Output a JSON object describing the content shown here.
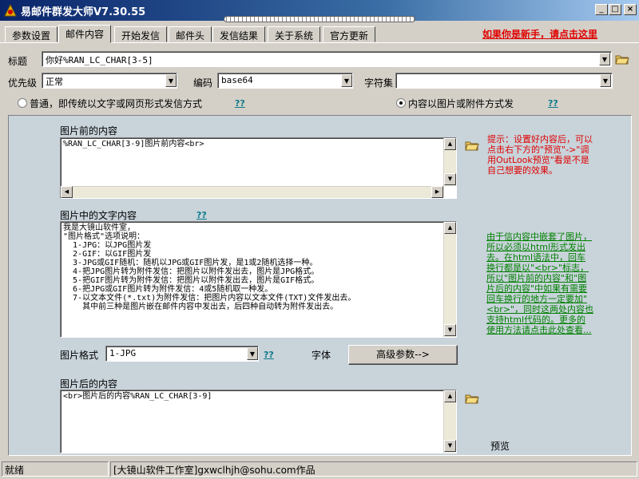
{
  "window": {
    "title": "易邮件群发大师V7.30.55"
  },
  "tabs": [
    "参数设置",
    "邮件内容",
    "开始发信",
    "邮件头",
    "发信结果",
    "关于系统",
    "官方更新"
  ],
  "newbie_link": "如果你是新手，请点击这里",
  "form": {
    "title_label": "标题",
    "title_value": "你好%RAN_LC_CHAR[3-5]",
    "priority_label": "优先级",
    "priority_value": "正常",
    "encoding_label": "编码",
    "encoding_value": "base64",
    "charset_label": "字符集",
    "charset_value": ""
  },
  "send_mode": {
    "normal_label": "普通，即传统以文字或网页形式发信方式",
    "image_label": "内容以图片或附件方式发",
    "help": "??",
    "selected": "image"
  },
  "before": {
    "label": "图片前的内容",
    "text": "%RAN_LC_CHAR[3-9]图片前内容<br>"
  },
  "tip_red": "提示：设置好内容后，可以点击右下方的\"预览\"->\"调用OutLook预览\"看是不是自己想要的效果。",
  "middle": {
    "label": "图片中的文字内容",
    "help": "??",
    "lines": [
      "我是大镜山软件室，",
      "",
      "\"图片格式\"选项说明：",
      "  1-JPG：以JPG图片发",
      "  2-GIF：以GIF图片发",
      "  3-JPG或GIF随机：随机以JPG或GIF图片发，是1或2随机选择一种。",
      "  4-把JPG图片转为附件发信：把图片以附件发出去，图片是JPG格式。",
      "  5-把GIF图片转为附件发信：把图片以附件发出去，图片是GIF格式。",
      "  6-把JPG或GIF图片转为附件发信：4或5随机取一种发。",
      "  7-以文本文件(*.txt)为附件发信：把图片内容以文本文件(TXT)文件发出去。",
      "    其中前三种是图片嵌在邮件内容中发出去，后四种自动转为附件发出去。"
    ]
  },
  "tip_green": "由于信内容中嵌套了图片，所以必须以html形式发出去。在html语法中，回车换行都是以\"<br>\"标志，所以\"图片前的内容\"和\"图片后的内容\"中如果有需要回车换行的地方一定要加\"<br>\"，同时这两处内容也支持html代码的。更多的使用方法请点击此处查看...",
  "image_format": {
    "label": "图片格式",
    "value": "1-JPG",
    "help": "??"
  },
  "font_label": "字体",
  "advanced_button": "高级参数-->",
  "after": {
    "label": "图片后的内容",
    "text": "<br>图片后的内容%RAN_LC_CHAR[3-9]"
  },
  "preview_label": "预览",
  "status": {
    "left": "就绪",
    "right": "[大镜山软件工作室]gxwclhjh@sohu.com作品"
  }
}
